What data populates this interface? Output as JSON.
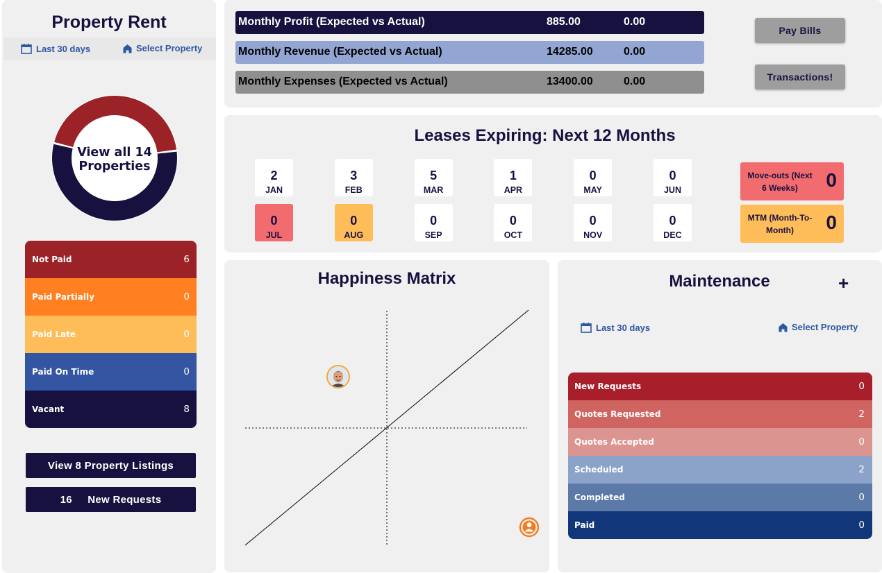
{
  "property_rent": {
    "title": "Property Rent",
    "filter_date": "Last 30 days",
    "filter_property": "Select Property",
    "donut_label": "View all 14 Properties",
    "donut_colors": {
      "upper": "#9b2226",
      "lower": "#16113f"
    },
    "statuses": [
      {
        "label": "Not Paid",
        "count": "6",
        "color": "#9b2226"
      },
      {
        "label": "Paid Partially",
        "count": "0",
        "color": "#ff7f21"
      },
      {
        "label": "Paid Late",
        "count": "0",
        "color": "#ffbd59"
      },
      {
        "label": "Paid On Time",
        "count": "0",
        "color": "#3355a2"
      },
      {
        "label": "Vacant",
        "count": "8",
        "color": "#16113f"
      }
    ],
    "listings_button": "View 8 Property Listings",
    "requests_button": "16     New Requests"
  },
  "summary": {
    "rows": [
      {
        "label": "Monthly Profit (Expected vs Actual)",
        "expected": "885.00",
        "actual": "0.00",
        "color": "#16113f",
        "text_color": "#ffffff"
      },
      {
        "label": "Monthly Revenue (Expected vs Actual)",
        "expected": "14285.00",
        "actual": "0.00",
        "color": "#93a6d3",
        "text_color": "#000000"
      },
      {
        "label": "Monthly Expenses (Expected vs Actual)",
        "expected": "13400.00",
        "actual": "0.00",
        "color": "#8f8f8f",
        "text_color": "#000000"
      }
    ],
    "pay_bills": "Pay Bills",
    "transactions": "Transactions!"
  },
  "leases": {
    "title": "Leases Expiring: Next 12 Months",
    "months": [
      {
        "count": "2",
        "month": "JAN",
        "color": "#ffffff"
      },
      {
        "count": "3",
        "month": "FEB",
        "color": "#ffffff"
      },
      {
        "count": "5",
        "month": "MAR",
        "color": "#ffffff"
      },
      {
        "count": "1",
        "month": "APR",
        "color": "#ffffff"
      },
      {
        "count": "0",
        "month": "MAY",
        "color": "#ffffff"
      },
      {
        "count": "0",
        "month": "JUN",
        "color": "#ffffff"
      },
      {
        "count": "0",
        "month": "JUL",
        "color": "#f26c6f"
      },
      {
        "count": "0",
        "month": "AUG",
        "color": "#ffbd59"
      },
      {
        "count": "0",
        "month": "SEP",
        "color": "#ffffff"
      },
      {
        "count": "0",
        "month": "OCT",
        "color": "#ffffff"
      },
      {
        "count": "0",
        "month": "NOV",
        "color": "#ffffff"
      },
      {
        "count": "0",
        "month": "DEC",
        "color": "#ffffff"
      }
    ],
    "moveouts": {
      "label": "Move-outs (Next 6 Weeks)",
      "value": "0",
      "color": "#f26c6f"
    },
    "mtm": {
      "label": "MTM (Month-To-Month)",
      "value": "0",
      "color": "#ffbd59"
    }
  },
  "happiness": {
    "title": "Happiness Matrix"
  },
  "maintenance": {
    "title": "Maintenance",
    "add_icon": "plus-icon",
    "filter_date": "Last 30 days",
    "filter_property": "Select Property",
    "rows": [
      {
        "label": "New Requests",
        "count": "0",
        "color": "#a81e2a"
      },
      {
        "label": "Quotes Requested",
        "count": "2",
        "color": "#cf6461"
      },
      {
        "label": "Quotes Accepted",
        "count": "0",
        "color": "#dc9491"
      },
      {
        "label": "Scheduled",
        "count": "2",
        "color": "#8ba2c9"
      },
      {
        "label": "Completed",
        "count": "0",
        "color": "#5c7aa8"
      },
      {
        "label": "Paid",
        "count": "0",
        "color": "#12367a"
      }
    ]
  }
}
